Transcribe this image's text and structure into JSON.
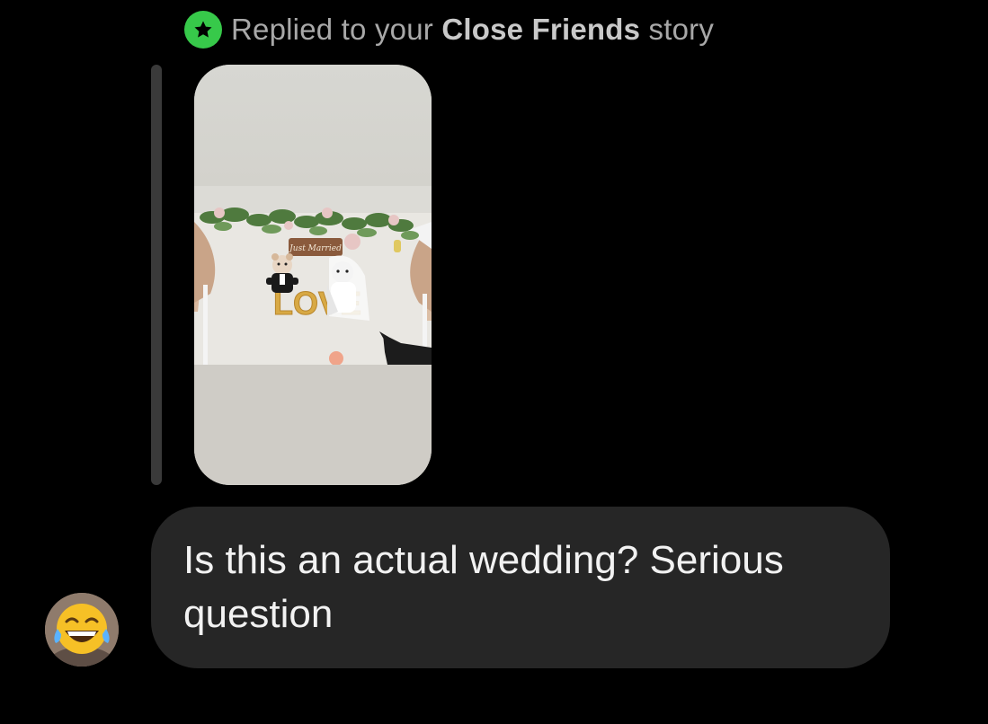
{
  "reply_header": {
    "prefix": "Replied to your",
    "highlight": "Close Friends",
    "suffix": "story",
    "icon": "close-friends-star-icon"
  },
  "story_preview": {
    "sign_text": "Just Married",
    "balloon_text": "LOVE"
  },
  "message": {
    "text": "Is this an actual wedding? Serious question",
    "sender_avatar": "avatar-laughing-emoji"
  },
  "colors": {
    "background": "#000000",
    "bubble": "#262626",
    "close_friends_green": "#37c94a",
    "muted_text": "#a8a8a8"
  }
}
